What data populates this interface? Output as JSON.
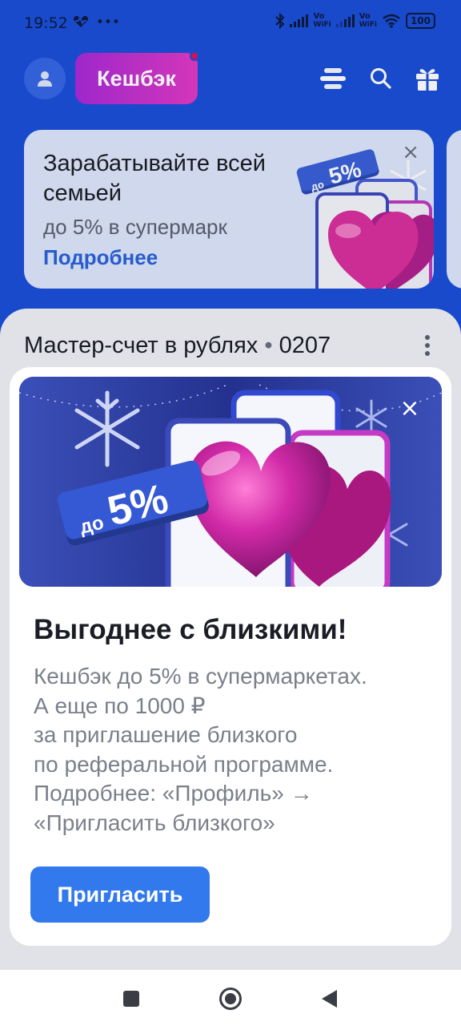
{
  "status_bar": {
    "time": "19:52",
    "left_icons": [
      "heart-rate-icon",
      "more-dots-icon"
    ],
    "right_icons": [
      "bluetooth-icon",
      "signal-icon",
      "vowifi-icon",
      "signal-icon",
      "vowifi-icon",
      "wifi-icon",
      "battery-icon"
    ],
    "vo_label": "Vo",
    "wifi_label": "WiFi",
    "battery": "100"
  },
  "header": {
    "cashback_label": "Кешбэк",
    "icons": [
      "avatar-icon",
      "menu-stack-icon",
      "search-icon",
      "gift-icon"
    ]
  },
  "promo": {
    "title": "Зарабатывайте всей семьей",
    "subtitle": "до 5% в супермарк",
    "link": "Подробнее",
    "badge_prefix": "до",
    "badge_value": "5%",
    "close": "×"
  },
  "account": {
    "title": "Мастер-счет в рублях",
    "separator": "•",
    "number": "0207"
  },
  "modal": {
    "badge_prefix": "до",
    "badge_value": "5%",
    "title": "Выгоднее с близкими!",
    "body_lines": [
      "Кешбэк до 5% в супермаркетах.",
      "А еще по 1000 ₽",
      "за приглашение близкого",
      "по реферальной программе.",
      "Подробнее: «Профиль» →",
      "«Пригласить близкого»"
    ],
    "button": "Пригласить",
    "close": "×"
  },
  "colors": {
    "background_blue": "#1a4fd8",
    "accent_blue": "#3379ee",
    "cashback_gradient_start": "#a82ad8",
    "cashback_gradient_end": "#e13ac5",
    "link_blue": "#2a62db"
  }
}
